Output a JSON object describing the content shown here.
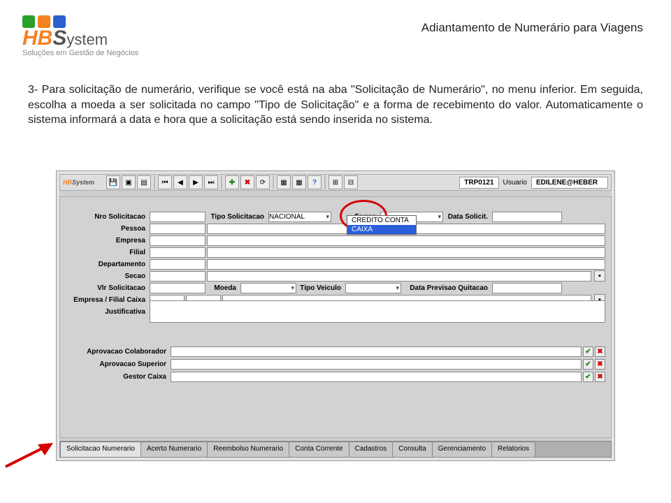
{
  "header": {
    "title": "Adiantamento de Numerário para Viagens",
    "logo_tagline": "Soluções em Gestão de Negócios"
  },
  "paragraph": {
    "text": "3- Para solicitação de numerário, verifique se você está na aba \"Solicitação de Numerário\", no menu inferior. Em seguida, escolha a moeda a ser solicitada no campo \"Tipo de Solicitação\" e a forma de recebimento do valor. Automaticamente o sistema informará a data e hora que a solicitação está sendo inserida no sistema."
  },
  "toolbar": {
    "code": "TRP0121",
    "user_label": "Usuario",
    "user_value": "EDILENE@HEBER"
  },
  "form": {
    "nro_solicitacao": "Nro Solicitacao",
    "tipo_solicitacao": "Tipo Solicitacao",
    "tipo_solicitacao_value": "NACIONAL",
    "forma": "Forma",
    "data_solicit": "Data Solicit.",
    "pessoa": "Pessoa",
    "empresa": "Empresa",
    "filial": "Filial",
    "departamento": "Departamento",
    "secao": "Secao",
    "vlr_solicitacao": "Vlr Solicitacao",
    "moeda": "Moeda",
    "tipo_veiculo": "Tipo Veiculo",
    "data_previsao": "Data Previsao Quitacao",
    "empresa_filial_caixa": "Empresa / Filial Caixa",
    "justificativa": "Justificativa",
    "dropdown": {
      "opt1": "CREDITO CONTA",
      "opt2": "CAIXA"
    }
  },
  "approvals": {
    "colaborador": "Aprovacao Colaborador",
    "superior": "Aprovacao Superior",
    "gestor": "Gestor Caixa"
  },
  "tabs": {
    "t1": "Solicitacao Numerario",
    "t2": "Acerto Numerario",
    "t3": "Reembolso Numerario",
    "t4": "Conta Corrente",
    "t5": "Cadastros",
    "t6": "Consulta",
    "t7": "Gerenciamento",
    "t8": "Relatorios"
  }
}
